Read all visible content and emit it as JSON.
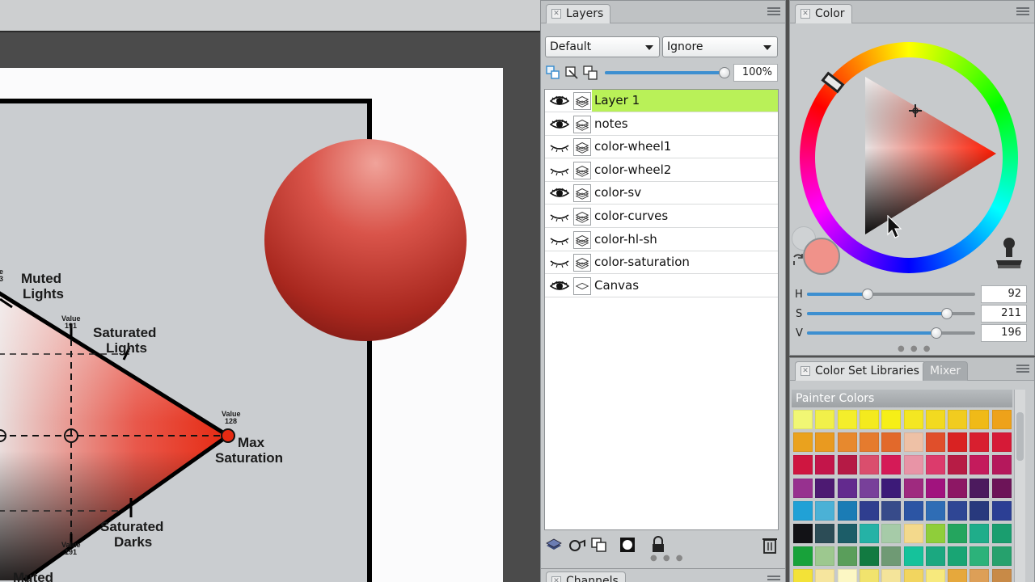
{
  "diagram": {
    "labels": {
      "muted_lights": [
        "Muted",
        "Lights"
      ],
      "saturated_lights": [
        "Saturated",
        "Lights"
      ],
      "max_saturation": [
        "Max",
        "Saturation"
      ],
      "saturated_darks": [
        "Saturated",
        "Darks"
      ],
      "muted_bottom": "Muted"
    },
    "value_tags": {
      "upper": [
        "Value",
        "191"
      ],
      "tip": [
        "Value",
        "128"
      ],
      "lower": [
        "Value",
        "191"
      ],
      "cut": [
        "e",
        "3"
      ]
    }
  },
  "layers_panel": {
    "title": "Layers",
    "composite_method": "Default",
    "depth_mode": "Ignore",
    "opacity": "100%",
    "opacity_fraction": 1.0,
    "layers": [
      {
        "name": "Layer 1",
        "eye": "open",
        "selected": true
      },
      {
        "name": "notes",
        "eye": "open",
        "selected": false
      },
      {
        "name": "color-wheel1",
        "eye": "closed",
        "selected": false
      },
      {
        "name": "color-wheel2",
        "eye": "closed",
        "selected": false
      },
      {
        "name": "color-sv",
        "eye": "open",
        "selected": false
      },
      {
        "name": "color-curves",
        "eye": "closed",
        "selected": false
      },
      {
        "name": "color-hl-sh",
        "eye": "closed",
        "selected": false
      },
      {
        "name": "color-saturation",
        "eye": "closed",
        "selected": false
      },
      {
        "name": "Canvas",
        "eye": "open",
        "selected": false
      }
    ]
  },
  "color_panel": {
    "title": "Color",
    "main_color": "#f0928a",
    "h": {
      "label": "H",
      "value": "92",
      "fraction": 0.36
    },
    "s": {
      "label": "S",
      "value": "211",
      "fraction": 0.83
    },
    "v": {
      "label": "V",
      "value": "196",
      "fraction": 0.77
    }
  },
  "color_set_panel": {
    "title": "Color Set Libraries",
    "tab_mixer": "Mixer",
    "library_name": "Painter Colors",
    "swatches": [
      [
        "#f1f774",
        "#f1f04a",
        "#f4ee2b",
        "#f4ea1e",
        "#f6ef17",
        "#f4e722",
        "#f2da20",
        "#f1cc1f",
        "#f0ba18",
        "#eea21a"
      ],
      [
        "#eaa21e",
        "#e99a20",
        "#e7892e",
        "#e57b2e",
        "#e2692b",
        "#eec1a6",
        "#e04f2b",
        "#d92222",
        "#d81f2f",
        "#d61a37"
      ],
      [
        "#cf1640",
        "#c3154a",
        "#b51a45",
        "#da4e6d",
        "#d51a57",
        "#e894a6",
        "#dc3b6c",
        "#b71c45",
        "#c41b5c",
        "#b5185c"
      ],
      [
        "#97318f",
        "#4d1a72",
        "#632a8e",
        "#78409a",
        "#3c1a78",
        "#9f2a7f",
        "#a1137e",
        "#8d1764",
        "#4c1a5e",
        "#6d1458"
      ],
      [
        "#21a1d6",
        "#4bb1d6",
        "#1b7cb5",
        "#2f3e8f",
        "#374b8a",
        "#2c55a4",
        "#2f6db5",
        "#2f4694",
        "#28397d",
        "#2c3f94"
      ],
      [
        "#121216",
        "#2c4c56",
        "#1c5d68",
        "#25b2a6",
        "#a6cba8",
        "#f3d98c",
        "#8fce3a",
        "#24a55e",
        "#1fad8a",
        "#1a9e6f"
      ],
      [
        "#18a23a",
        "#9dc88f",
        "#5a9e5b",
        "#127a41",
        "#6f9a74",
        "#15c29b",
        "#1ba880",
        "#19a574",
        "#2cb27a",
        "#26a16d"
      ],
      [
        "#f3e237",
        "#f6e59e",
        "#fcf7c4",
        "#f1e36d",
        "#f4e49a",
        "#f2d55f",
        "#f7e97d",
        "#e6a83c",
        "#dd9f57",
        "#c88a47"
      ]
    ]
  },
  "channels_panel": {
    "title": "Channels"
  }
}
